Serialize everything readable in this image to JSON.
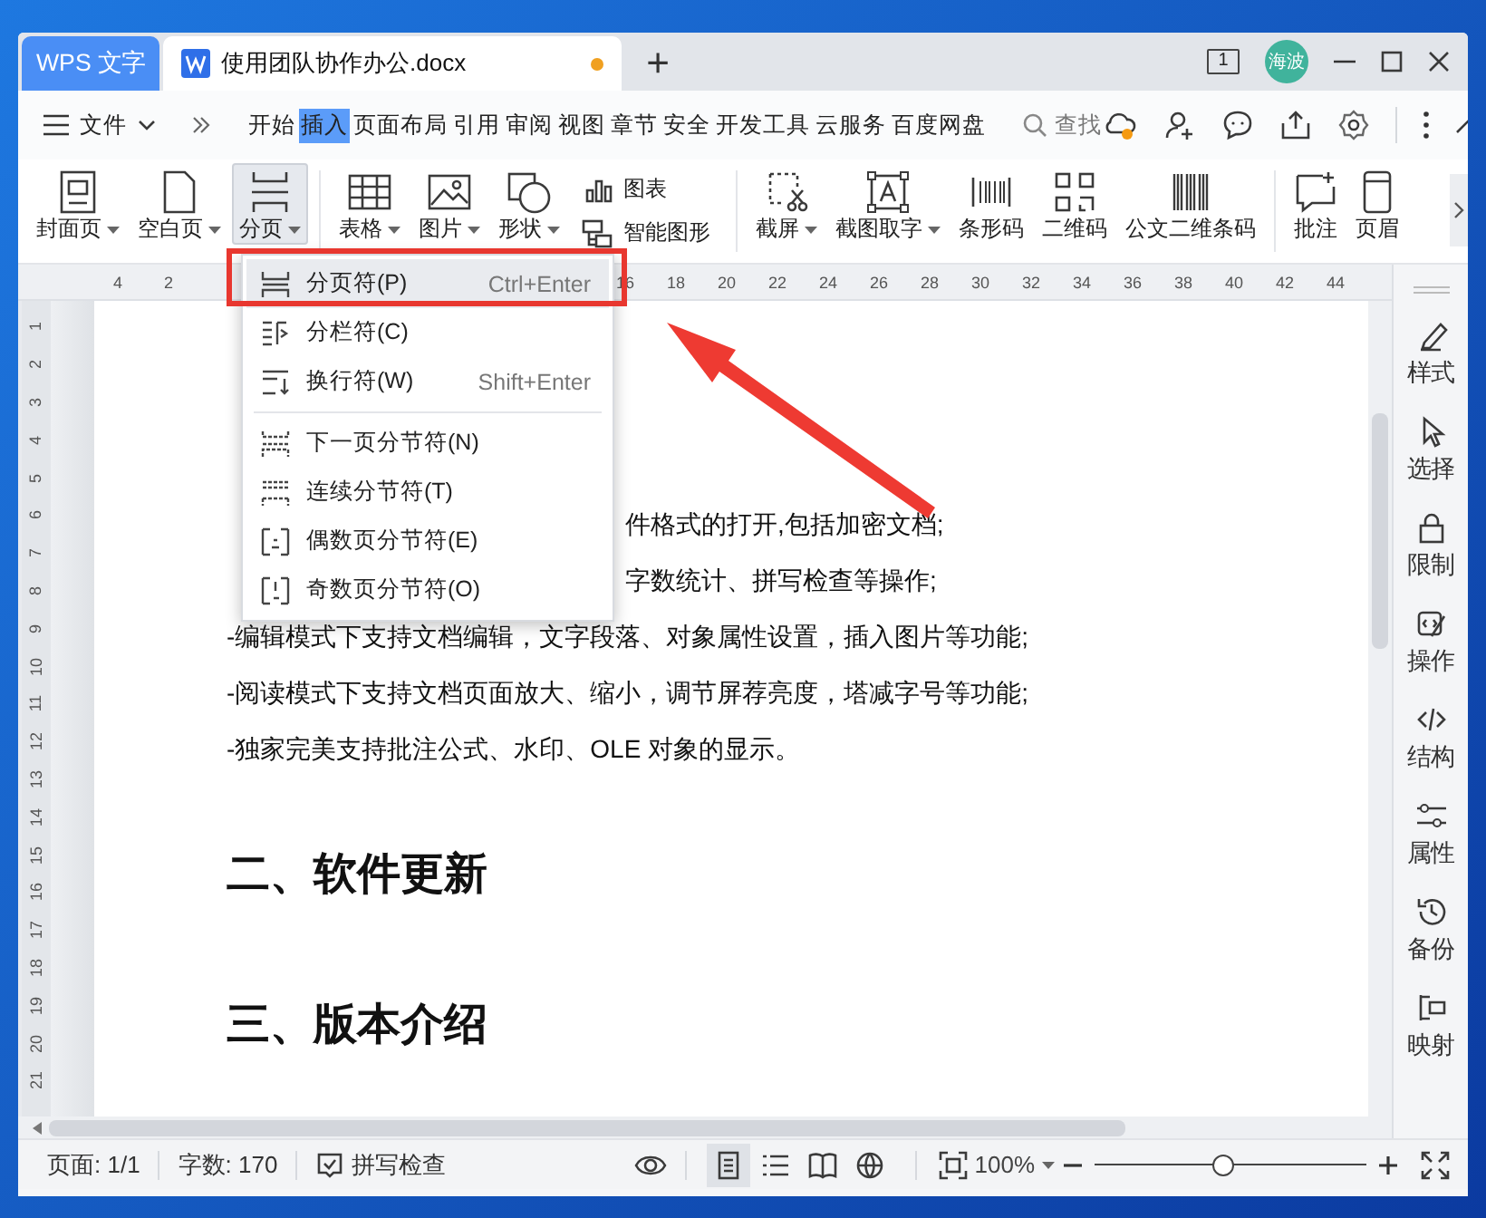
{
  "title_bar": {
    "app_tab": "WPS 文字",
    "doc_tab": {
      "title": "使用团队协作办公.docx",
      "unsaved": true
    },
    "new_tab": "+",
    "page_indicator": "1",
    "avatar": "海波"
  },
  "menu_bar": {
    "file": "文件",
    "tabs": [
      {
        "label": "开始",
        "selected": false
      },
      {
        "label": "插入",
        "selected": true
      },
      {
        "label": "页面布局",
        "selected": false
      },
      {
        "label": "引用",
        "selected": false
      },
      {
        "label": "审阅",
        "selected": false
      },
      {
        "label": "视图",
        "selected": false
      },
      {
        "label": "章节",
        "selected": false
      },
      {
        "label": "安全",
        "selected": false
      },
      {
        "label": "开发工具",
        "selected": false
      },
      {
        "label": "云服务",
        "selected": false
      },
      {
        "label": "百度网盘",
        "selected": false
      }
    ],
    "search": "查找"
  },
  "ribbon": [
    {
      "kind": "large",
      "label": "封面页",
      "has_menu": true,
      "open": false
    },
    {
      "kind": "large",
      "label": "空白页",
      "has_menu": true,
      "open": false
    },
    {
      "kind": "large",
      "label": "分页",
      "has_menu": true,
      "open": true
    },
    {
      "kind": "large",
      "label": "表格",
      "has_menu": true,
      "open": false
    },
    {
      "kind": "large",
      "label": "图片",
      "has_menu": true,
      "open": false
    },
    {
      "kind": "large",
      "label": "形状",
      "has_menu": true,
      "open": false
    },
    {
      "kind": "small",
      "label": "图表",
      "has_menu": false,
      "open": false
    },
    {
      "kind": "small",
      "label": "智能图形",
      "has_menu": false,
      "open": false
    },
    {
      "kind": "large",
      "label": "截屏",
      "has_menu": true,
      "open": false
    },
    {
      "kind": "large",
      "label": "截图取字",
      "has_menu": true,
      "open": false
    },
    {
      "kind": "large",
      "label": "条形码",
      "has_menu": false,
      "open": false
    },
    {
      "kind": "large",
      "label": "二维码",
      "has_menu": false,
      "open": false
    },
    {
      "kind": "large",
      "label": "公文二维条码",
      "has_menu": false,
      "open": false
    },
    {
      "kind": "large",
      "label": "批注",
      "has_menu": false,
      "open": false
    },
    {
      "kind": "large",
      "label": "页眉",
      "has_menu": false,
      "open": false
    }
  ],
  "ruler": {
    "left_numbers": [
      "4",
      "2"
    ],
    "right_numbers": [
      "16",
      "18",
      "20",
      "22",
      "24",
      "26",
      "28",
      "30",
      "32",
      "34",
      "36",
      "38",
      "40",
      "42",
      "44"
    ],
    "side_numbers": [
      "1",
      "2",
      "3",
      "4",
      "5",
      "6",
      "7",
      "8",
      "9",
      "10",
      "11",
      "12",
      "13",
      "14",
      "15",
      "16",
      "17",
      "18",
      "19",
      "20",
      "21"
    ]
  },
  "dropdown_menu": {
    "groups": [
      {
        "items": [
          {
            "label": "分页符(P)",
            "shortcut": "Ctrl+Enter",
            "selected": true
          },
          {
            "label": "分栏符(C)",
            "selected": false
          },
          {
            "label": "换行符(W)",
            "shortcut": "Shift+Enter",
            "selected": false
          }
        ]
      },
      {
        "items": [
          {
            "label": "下一页分节符(N)",
            "selected": false
          },
          {
            "label": "连续分节符(T)",
            "selected": false
          },
          {
            "label": "偶数页分节符(E)",
            "selected": false
          },
          {
            "label": "奇数页分节符(O)",
            "selected": false
          }
        ]
      }
    ]
  },
  "document": {
    "paragraphs": [
      {
        "kind": "partial",
        "text": "件格式的打开,包括加密文档;"
      },
      {
        "kind": "partial",
        "text": "字数统计、拼写检查等操作;"
      },
      {
        "kind": "line",
        "text": "-编辑模式下支持文档编辑，文字段落、对象属性设置，插入图片等功能;"
      },
      {
        "kind": "line",
        "text": "-阅读模式下支持文档页面放大、缩小，调节屏荐亮度，塔减字号等功能;"
      },
      {
        "kind": "line",
        "text": "-独家完美支持批注公式、水印、OLE  对象的显示。"
      },
      {
        "kind": "heading",
        "text": "二、软件更新"
      },
      {
        "kind": "heading",
        "text": "三、版本介绍"
      }
    ]
  },
  "side_panel": [
    "样式",
    "选择",
    "限制",
    "操作",
    "结构",
    "属性",
    "备份",
    "映射"
  ],
  "status_bar": {
    "page": "页面: 1/1",
    "words": "字数: 170",
    "spell_check": "拼写检查",
    "view_modes": [
      {
        "selected": true
      },
      {
        "selected": false
      },
      {
        "selected": false
      },
      {
        "selected": false
      }
    ],
    "zoom": "100%",
    "zoom_level": {
      "level": 0.47
    }
  }
}
